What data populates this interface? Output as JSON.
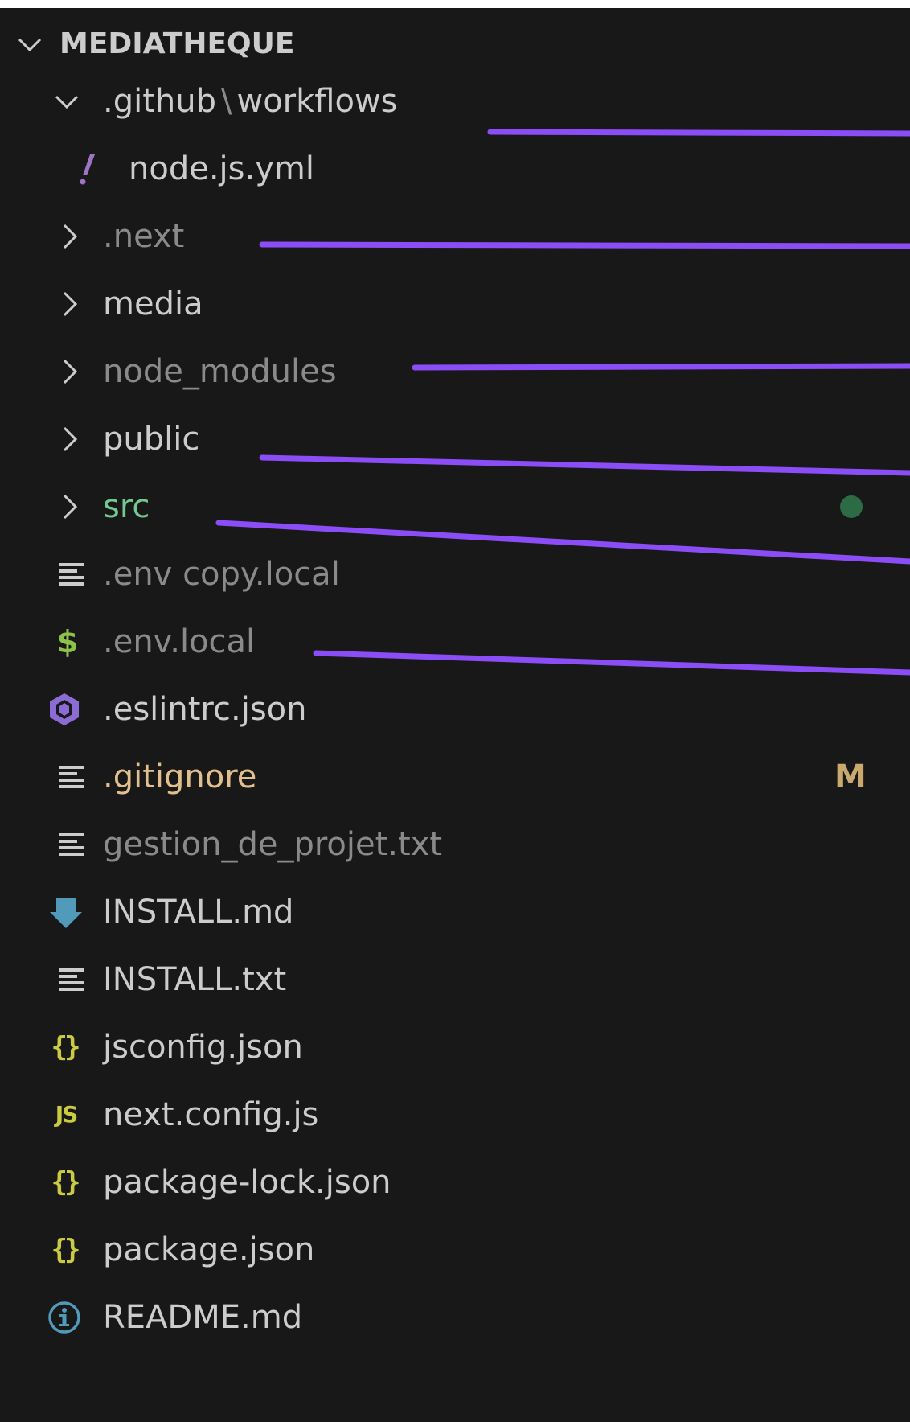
{
  "explorer": {
    "section_title": "MEDIATHEQUE",
    "items": [
      {
        "label": "",
        "type": "folder",
        "expanded": true,
        "path_parts": [
          ".github",
          "workflows"
        ],
        "path_separator": "\\",
        "icon": "chevron-down-icon",
        "color": "#cccccc"
      },
      {
        "label": "node.js.yml",
        "type": "file",
        "icon": "yaml-exclamation-icon",
        "color": "#cccccc"
      },
      {
        "label": ".next",
        "type": "folder",
        "expanded": false,
        "icon": "chevron-right-icon",
        "color": "#8a8a8a"
      },
      {
        "label": "media",
        "type": "folder",
        "expanded": false,
        "icon": "chevron-right-icon",
        "color": "#cccccc"
      },
      {
        "label": "node_modules",
        "type": "folder",
        "expanded": false,
        "icon": "chevron-right-icon",
        "color": "#8a8a8a"
      },
      {
        "label": "public",
        "type": "folder",
        "expanded": false,
        "icon": "chevron-right-icon",
        "color": "#cccccc"
      },
      {
        "label": "src",
        "type": "folder",
        "expanded": false,
        "icon": "chevron-right-icon",
        "color": "#73c991",
        "decoration": "dot"
      },
      {
        "label": ".env copy.local",
        "type": "file",
        "icon": "text-lines-icon",
        "color": "#8a8a8a"
      },
      {
        "label": ".env.local",
        "type": "file",
        "icon": "dollar-icon",
        "color": "#8a8a8a"
      },
      {
        "label": ".eslintrc.json",
        "type": "file",
        "icon": "eslint-icon",
        "color": "#cccccc"
      },
      {
        "label": ".gitignore",
        "type": "file",
        "icon": "text-lines-icon",
        "color": "#e2c08d",
        "decoration": "M"
      },
      {
        "label": "gestion_de_projet.txt",
        "type": "file",
        "icon": "text-lines-icon",
        "color": "#8a8a8a"
      },
      {
        "label": "INSTALL.md",
        "type": "file",
        "icon": "markdown-icon",
        "color": "#cccccc"
      },
      {
        "label": "INSTALL.txt",
        "type": "file",
        "icon": "text-lines-icon",
        "color": "#cccccc"
      },
      {
        "label": "jsconfig.json",
        "type": "file",
        "icon": "json-braces-icon",
        "color": "#cccccc"
      },
      {
        "label": "next.config.js",
        "type": "file",
        "icon": "js-icon",
        "color": "#cccccc"
      },
      {
        "label": "package-lock.json",
        "type": "file",
        "icon": "json-braces-icon",
        "color": "#cccccc"
      },
      {
        "label": "package.json",
        "type": "file",
        "icon": "json-braces-icon",
        "color": "#cccccc"
      },
      {
        "label": "README.md",
        "type": "file",
        "icon": "info-icon",
        "color": "#cccccc"
      }
    ],
    "git_badge_text": "M"
  },
  "annotation_color": "#8b4df5"
}
